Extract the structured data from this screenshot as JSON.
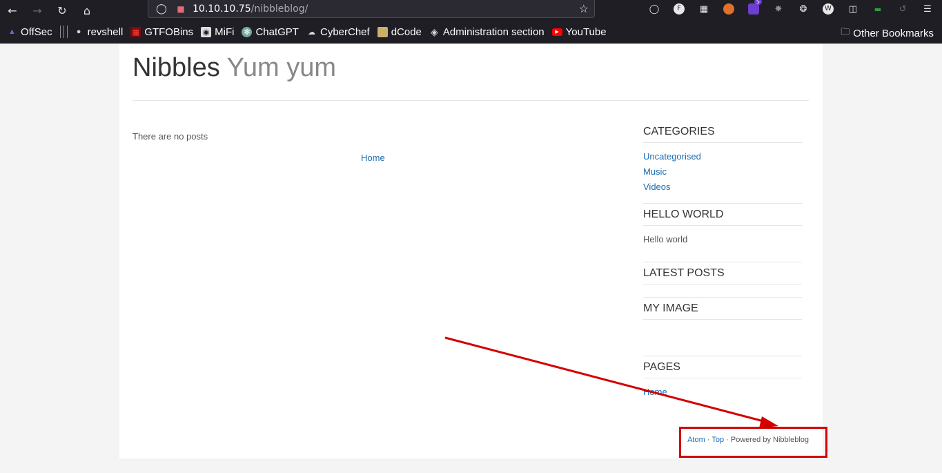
{
  "browser": {
    "url_host": "10.10.10.75",
    "url_path": "/nibbleblog/",
    "extension_badge": "5",
    "bookmarks": [
      {
        "label": "OffSec",
        "icon": "offsec-icon",
        "color": "#7d5cd6"
      },
      {
        "label": "revshell",
        "icon": "skull-icon",
        "color": "#cfcfcf"
      },
      {
        "label": "GTFOBins",
        "icon": "gtfobins-icon",
        "color": "#b01818"
      },
      {
        "label": "MiFi",
        "icon": "mifi-icon",
        "color": "#dddddd"
      },
      {
        "label": "ChatGPT",
        "icon": "chatgpt-icon",
        "color": "#74aa9c"
      },
      {
        "label": "CyberChef",
        "icon": "chef-hat-icon",
        "color": "#dddddd"
      },
      {
        "label": "dCode",
        "icon": "dcode-icon",
        "color": "#c9b16a"
      },
      {
        "label": "Administration section",
        "icon": "globe-icon",
        "color": "#dddddd"
      },
      {
        "label": "YouTube",
        "icon": "youtube-icon",
        "color": "#ff0000"
      }
    ],
    "other_bookmarks": "Other Bookmarks"
  },
  "blog": {
    "title": "Nibbles",
    "slogan": "Yum yum",
    "no_posts": "There are no posts",
    "pager_home": "Home",
    "sidebar": {
      "categories_title": "CATEGORIES",
      "categories": [
        "Uncategorised",
        "Music",
        "Videos"
      ],
      "hello_title": "HELLO WORLD",
      "hello_text": "Hello world",
      "latest_title": "LATEST POSTS",
      "image_title": "MY IMAGE",
      "pages_title": "PAGES",
      "pages": [
        "Home"
      ]
    },
    "footer": {
      "atom": "Atom",
      "sep1": " · ",
      "top": "Top",
      "powered": " · Powered by Nibbleblog"
    }
  },
  "annotation": {
    "color": "#d40000"
  }
}
